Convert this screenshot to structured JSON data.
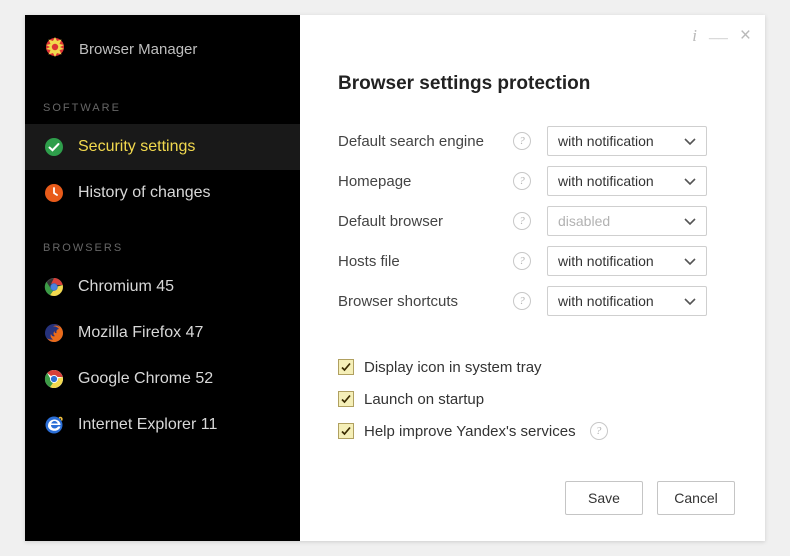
{
  "brand": {
    "title": "Browser Manager"
  },
  "sections": {
    "software": {
      "header": "SOFTWARE",
      "items": [
        {
          "label": "Security settings",
          "active": true
        },
        {
          "label": "History of changes"
        }
      ]
    },
    "browsers": {
      "header": "BROWSERS",
      "items": [
        {
          "label": "Chromium 45"
        },
        {
          "label": "Mozilla Firefox 47"
        },
        {
          "label": "Google Chrome 52"
        },
        {
          "label": "Internet Explorer 11"
        }
      ]
    }
  },
  "main": {
    "title": "Browser settings protection",
    "rows": [
      {
        "label": "Default search engine",
        "value": "with notification",
        "disabled": false
      },
      {
        "label": "Homepage",
        "value": "with notification",
        "disabled": false
      },
      {
        "label": "Default browser",
        "value": "disabled",
        "disabled": true
      },
      {
        "label": "Hosts file",
        "value": "with notification",
        "disabled": false
      },
      {
        "label": "Browser shortcuts",
        "value": "with notification",
        "disabled": false
      }
    ],
    "checks": [
      {
        "label": "Display icon in system tray",
        "checked": true
      },
      {
        "label": "Launch on startup",
        "checked": true
      },
      {
        "label": "Help improve Yandex's services",
        "checked": true,
        "info": true
      }
    ],
    "buttons": {
      "save": "Save",
      "cancel": "Cancel"
    }
  }
}
